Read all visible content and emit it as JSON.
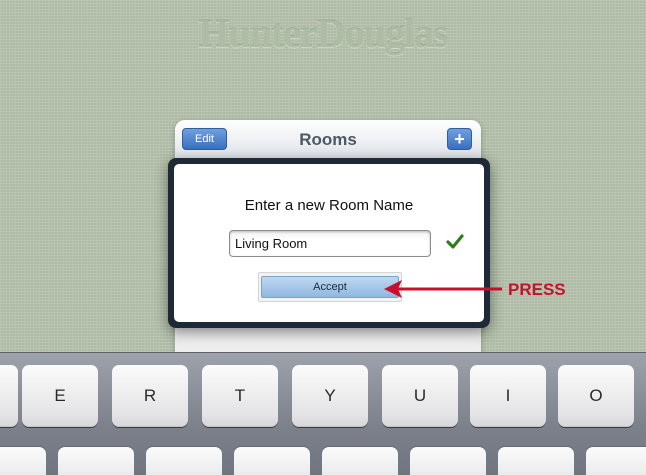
{
  "app": {
    "brand": "HunterDouglas"
  },
  "rooms_panel": {
    "title": "Rooms",
    "edit_label": "Edit",
    "add_label": "+"
  },
  "dialog": {
    "title": "Enter a new Room Name",
    "input_value": "Living Room",
    "accept_label": "Accept",
    "check_icon": "checkmark-icon"
  },
  "annotation": {
    "label": "PRESS",
    "color": "#c8102e"
  },
  "keyboard": {
    "row1": [
      "",
      "E",
      "R",
      "T",
      "Y",
      "U",
      "I",
      "O"
    ]
  },
  "colors": {
    "background": "#b8c5ae",
    "button_blue": "#3a70c2",
    "check_green": "#2f7d1f",
    "dialog_border": "#1f2a38"
  }
}
